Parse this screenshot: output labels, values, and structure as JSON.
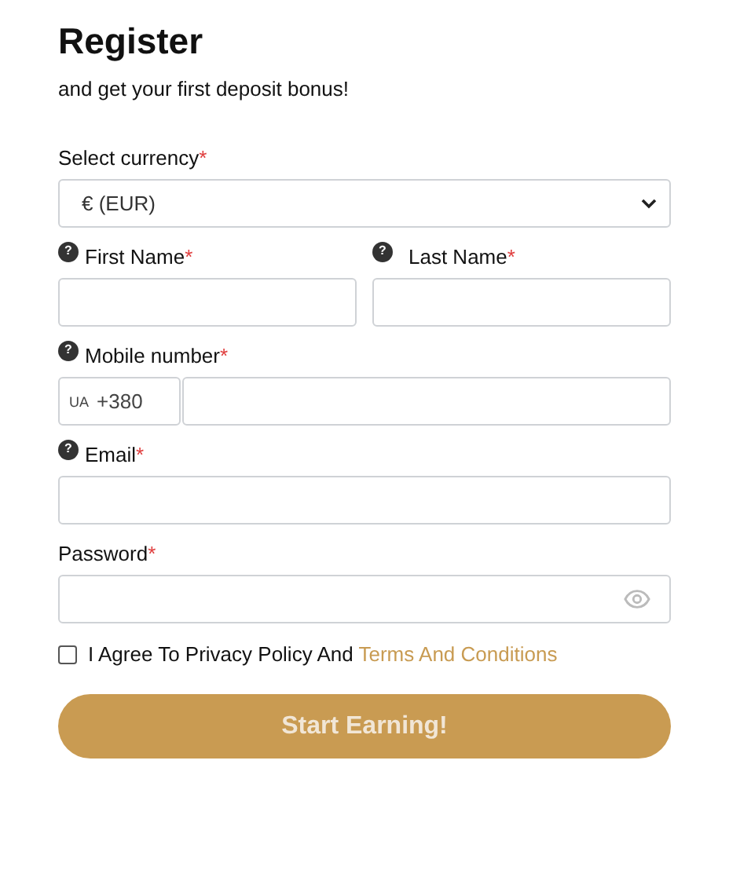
{
  "title": "Register",
  "subtitle": "and get your first deposit bonus!",
  "rows": [
    [
      {
        "kind": "select",
        "label": "Select currency",
        "required_mark": "*",
        "value": "€ (EUR)"
      }
    ],
    [
      {
        "kind": "text",
        "hint_icon": "?",
        "label": "First Name",
        "required_mark": "*"
      },
      {
        "kind": "text",
        "hint_icon": "?",
        "label": "Last Name",
        "required_mark": "*"
      }
    ],
    [
      {
        "kind": "phone",
        "hint_icon": "?",
        "label": "Mobile number",
        "required_mark": "*",
        "country": "UA",
        "code": "+380"
      }
    ],
    [
      {
        "kind": "text",
        "hint_icon": "?",
        "label": "Email",
        "required_mark": "*"
      }
    ],
    [
      {
        "kind": "password",
        "label": "Password",
        "required_mark": "*"
      }
    ]
  ],
  "agreement": {
    "checked": false,
    "text": "I Agree To Privacy Policy And",
    "link": "Terms And Conditions"
  },
  "button": {
    "label": "Start Earning!"
  }
}
